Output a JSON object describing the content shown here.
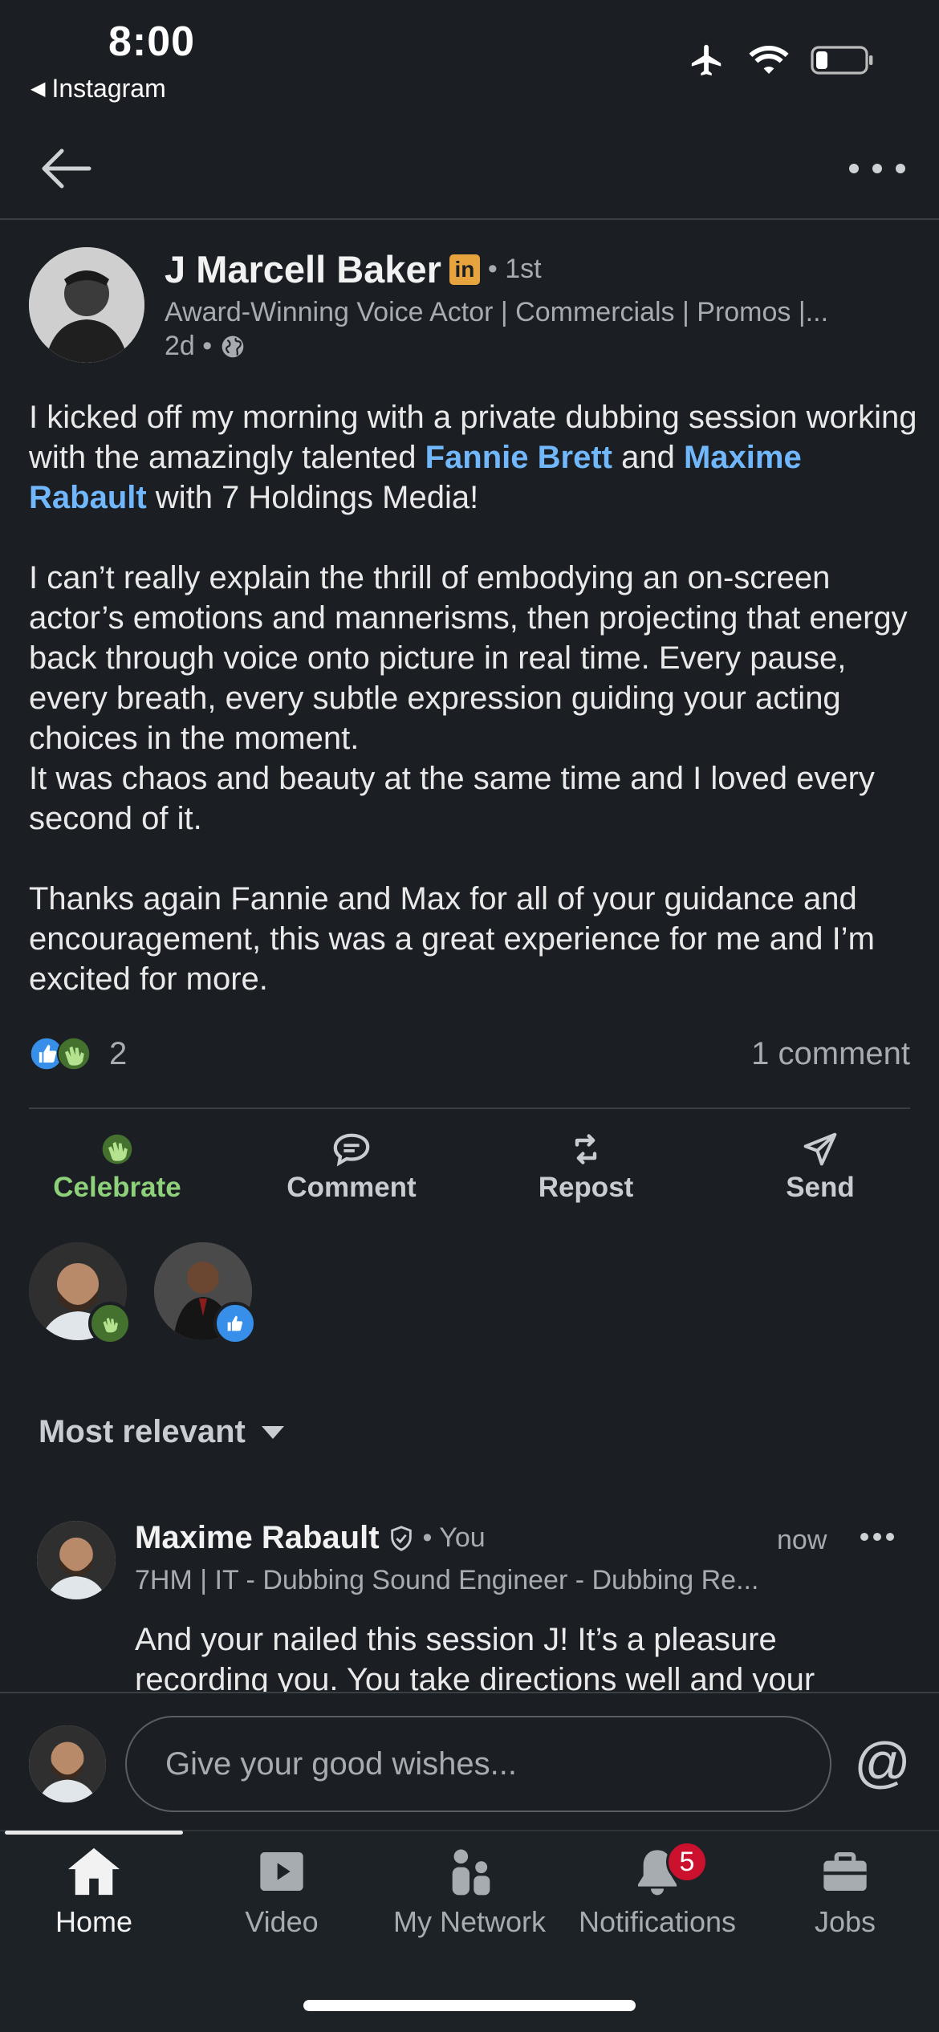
{
  "status_bar": {
    "time": "8:00",
    "back_app": "Instagram"
  },
  "post": {
    "author": {
      "name": "J Marcell Baker",
      "badge": "in",
      "degree": "• 1st",
      "headline": "Award-Winning Voice Actor | Commercials | Promos |...",
      "time": "2d •"
    },
    "body": {
      "p1_a": "I kicked off my morning with a private dubbing session working with the amazingly talented ",
      "p1_mention1": "Fannie Brett",
      "p1_b": " and ",
      "p1_mention2": "Maxime Rabault",
      "p1_c": " with 7 Holdings Media!",
      "p2": "I can’t really explain the thrill of embodying an on-screen actor’s emotions and mannerisms, then projecting that energy back through voice onto picture in real time. Every pause, every breath, every subtle expression guiding your acting choices in the moment.",
      "p2b": "It was chaos and beauty at the same time and I loved every second of it.",
      "p3": "Thanks again Fannie and Max for all of your guidance and encouragement, this was a great experience for me and I’m excited for more."
    },
    "reaction_count": "2",
    "comment_count": "1 comment"
  },
  "actions": {
    "celebrate": "Celebrate",
    "comment": "Comment",
    "repost": "Repost",
    "send": "Send"
  },
  "sort": {
    "label": "Most relevant"
  },
  "comment": {
    "name": "Maxime Rabault",
    "you": "• You",
    "time": "now",
    "headline": "7HM | IT - Dubbing Sound Engineer - Dubbing Re...",
    "text": "And your nailed this session J! It’s a pleasure recording you. You take directions well and your"
  },
  "composer": {
    "placeholder": "Give your good wishes...",
    "at": "@"
  },
  "tabs": {
    "home": "Home",
    "video": "Video",
    "network": "My Network",
    "notifications": "Notifications",
    "notifications_badge": "5",
    "jobs": "Jobs"
  },
  "colors": {
    "background": "#1b1f23",
    "mention": "#71b7fb",
    "celebrate": "#8fd17a",
    "badge_red": "#cb112d",
    "linkedin_gold": "#e7a33e"
  }
}
